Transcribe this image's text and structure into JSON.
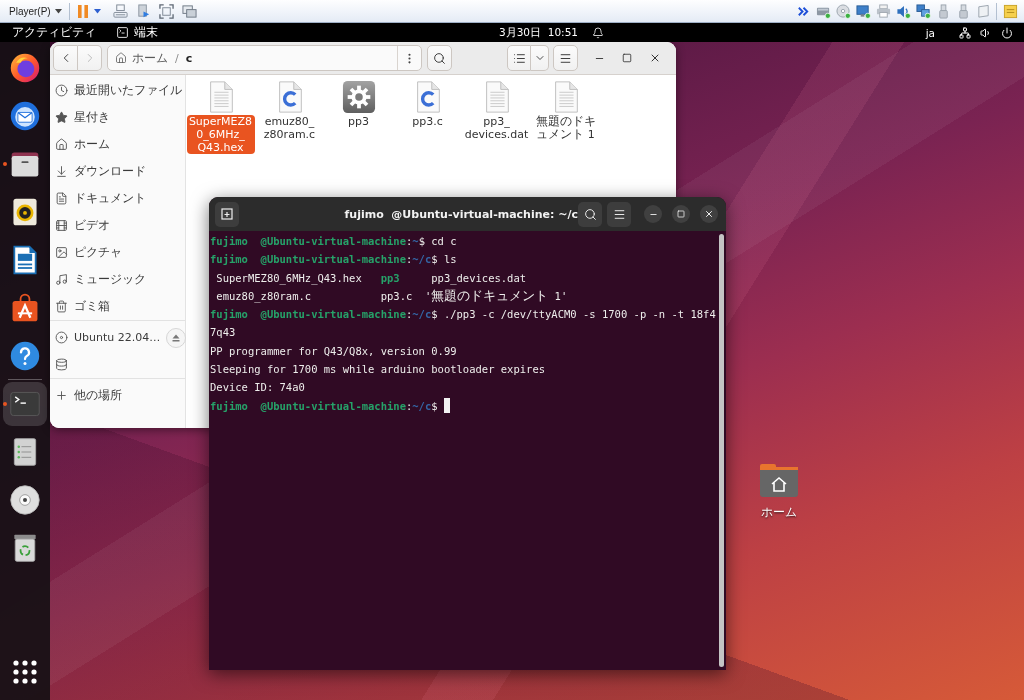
{
  "vm_toolbar": {
    "menu": "Player(P)",
    "devices": [
      {
        "kind": "disk",
        "connected": true
      },
      {
        "kind": "disc",
        "connected": true
      },
      {
        "kind": "network",
        "connected": true
      },
      {
        "kind": "printer",
        "connected": false
      },
      {
        "kind": "sound",
        "connected": true
      },
      {
        "kind": "display",
        "connected": true
      },
      {
        "kind": "usb",
        "connected": false
      },
      {
        "kind": "usb",
        "connected": false
      },
      {
        "kind": "card",
        "connected": false
      }
    ]
  },
  "top_bar": {
    "activities": "アクティビティ",
    "app": "端末",
    "clock": "3月30日  10:51",
    "input_method": "ja"
  },
  "dock": {
    "pinned": [
      {
        "kind": "browser",
        "running": false,
        "active": false
      },
      {
        "kind": "mail",
        "running": false,
        "active": false
      },
      {
        "kind": "files",
        "running": true,
        "active": false
      },
      {
        "kind": "music",
        "running": false,
        "active": false
      },
      {
        "kind": "writer",
        "running": false,
        "active": false
      },
      {
        "kind": "store",
        "running": false,
        "active": false
      },
      {
        "kind": "help",
        "running": false,
        "active": false
      }
    ],
    "others": [
      {
        "kind": "terminal",
        "running": true,
        "active": true
      },
      {
        "kind": "drive",
        "running": false,
        "active": false
      },
      {
        "kind": "disc",
        "running": false,
        "active": false
      },
      {
        "kind": "trash",
        "running": false,
        "active": false
      }
    ]
  },
  "file_manager": {
    "back_disabled": false,
    "forward_disabled": true,
    "path_separator": "/",
    "path": [
      {
        "label": "ホーム",
        "kind": "home",
        "current": false
      },
      {
        "label": "c",
        "kind": "folder",
        "current": true
      }
    ],
    "sidebar": [
      {
        "items": [
          {
            "kind": "recent",
            "label": "最近開いたファイル",
            "selected": false
          },
          {
            "kind": "starred",
            "label": "星付き",
            "selected": false
          },
          {
            "kind": "home",
            "label": "ホーム",
            "selected": false
          },
          {
            "kind": "downloads",
            "label": "ダウンロード",
            "selected": false
          },
          {
            "kind": "documents",
            "label": "ドキュメント",
            "selected": false
          },
          {
            "kind": "videos",
            "label": "ビデオ",
            "selected": false
          },
          {
            "kind": "pictures",
            "label": "ピクチャ",
            "selected": false
          },
          {
            "kind": "music",
            "label": "ミュージック",
            "selected": false
          },
          {
            "kind": "trash",
            "label": "ゴミ箱",
            "selected": false
          }
        ]
      },
      {
        "items": [
          {
            "kind": "disc",
            "label": "Ubuntu 22.04…",
            "selected": false,
            "ejectable": true
          },
          {
            "kind": "drive",
            "selected": false,
            "ejectable": false
          }
        ]
      },
      {
        "items": [
          {
            "kind": "other",
            "label": "他の場所",
            "selected": false
          }
        ]
      }
    ],
    "files": [
      {
        "name": "SuperMEZ80_6MHz_Q43.hex",
        "kind": "text",
        "selected": true
      },
      {
        "name": "emuz80_z80ram.c",
        "kind": "c-source",
        "selected": false
      },
      {
        "name": "pp3",
        "kind": "executable",
        "selected": false
      },
      {
        "name": "pp3.c",
        "kind": "c-source",
        "selected": false
      },
      {
        "name": "pp3_devices.dat",
        "kind": "text",
        "selected": false
      },
      {
        "name": "無題のドキュメント 1",
        "kind": "text",
        "selected": false
      }
    ]
  },
  "terminal": {
    "title": "fujimo  @Ubuntu-virtual-machine: ~/c",
    "lines": [
      {
        "cursor": false,
        "segments": [
          {
            "kind": "user",
            "text": "fujimo  @Ubuntu-virtual-machine"
          },
          {
            "kind": "plain",
            "text": ":"
          },
          {
            "kind": "path",
            "text": "~"
          },
          {
            "kind": "plain",
            "text": "$ cd c"
          }
        ]
      },
      {
        "cursor": false,
        "segments": [
          {
            "kind": "user",
            "text": "fujimo  @Ubuntu-virtual-machine"
          },
          {
            "kind": "plain",
            "text": ":"
          },
          {
            "kind": "path",
            "text": "~/c"
          },
          {
            "kind": "plain",
            "text": "$ ls"
          }
        ]
      },
      {
        "cursor": false,
        "segments": [
          {
            "kind": "plain",
            "text": " SuperMEZ80_6MHz_Q43.hex   "
          },
          {
            "kind": "exec",
            "text": "pp3"
          },
          {
            "kind": "plain",
            "text": "     pp3_devices.dat"
          }
        ]
      },
      {
        "cursor": false,
        "segments": [
          {
            "kind": "plain",
            "text": " emuz80_z80ram.c           pp3.c  '無題のドキュメント 1'"
          }
        ]
      },
      {
        "cursor": false,
        "segments": [
          {
            "kind": "user",
            "text": "fujimo  @Ubuntu-virtual-machine"
          },
          {
            "kind": "plain",
            "text": ":"
          },
          {
            "kind": "path",
            "text": "~/c"
          },
          {
            "kind": "plain",
            "text": "$ ./pp3 -c /dev/ttyACM0 -s 1700 -p -n -t 18f4"
          }
        ]
      },
      {
        "cursor": false,
        "segments": [
          {
            "kind": "plain",
            "text": "7q43"
          }
        ]
      },
      {
        "cursor": false,
        "segments": [
          {
            "kind": "plain",
            "text": "PP programmer for Q43/Q8x, version 0.99"
          }
        ]
      },
      {
        "cursor": false,
        "segments": [
          {
            "kind": "plain",
            "text": "Sleeping for 1700 ms while arduino bootloader expires"
          }
        ]
      },
      {
        "cursor": false,
        "segments": [
          {
            "kind": "plain",
            "text": "Device ID: 74a0"
          }
        ]
      },
      {
        "cursor": true,
        "segments": [
          {
            "kind": "user",
            "text": "fujimo  @Ubuntu-virtual-machine"
          },
          {
            "kind": "plain",
            "text": ":"
          },
          {
            "kind": "path",
            "text": "~/c"
          },
          {
            "kind": "plain",
            "text": "$ "
          }
        ]
      }
    ]
  },
  "desktop_icons": [
    {
      "label": "ホーム",
      "kind": "home"
    }
  ]
}
